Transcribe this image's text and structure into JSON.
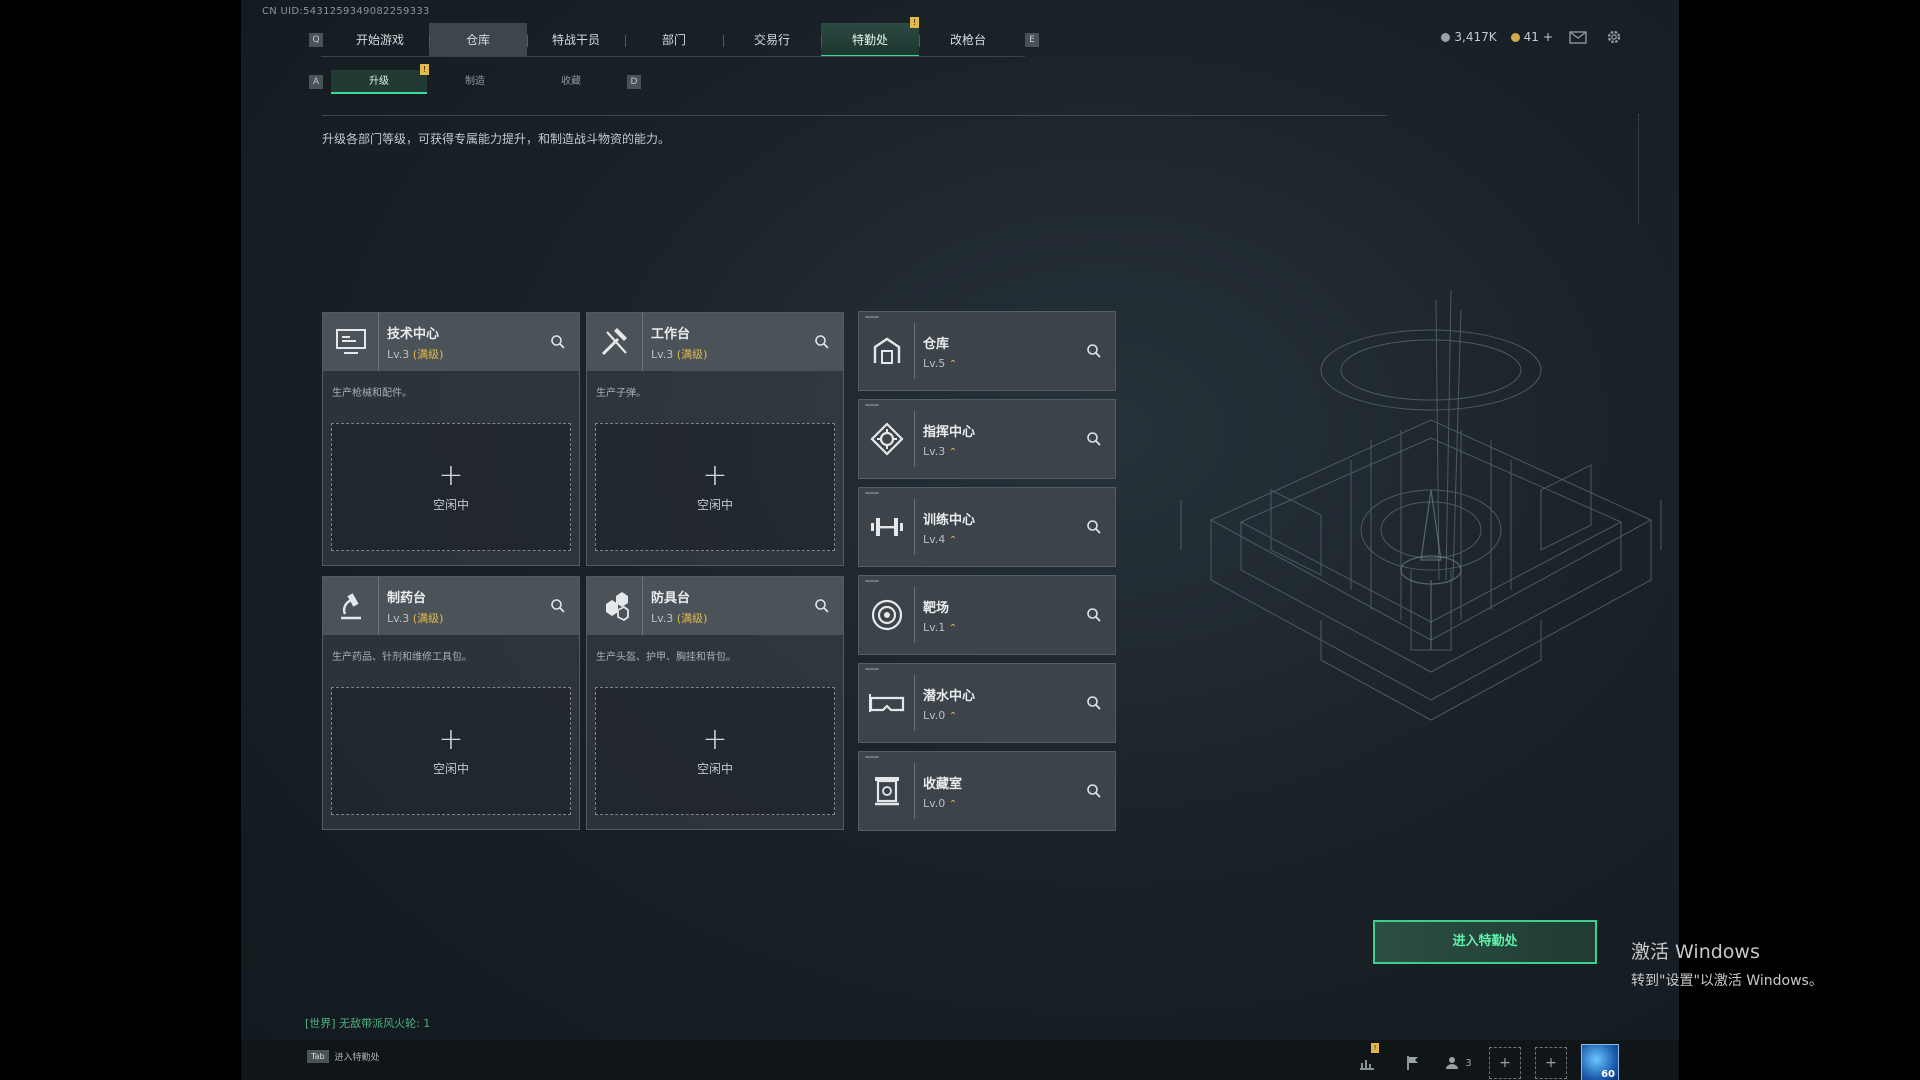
{
  "uid": "CN UID:5431259349082259333",
  "nav": {
    "left_key": "Q",
    "right_key": "E",
    "tabs": [
      "开始游戏",
      "仓库",
      "特战干员",
      "部门",
      "交易行",
      "特勤处",
      "改枪台"
    ],
    "active_tab": "特勤处",
    "alert": "!"
  },
  "resources": {
    "currency": "3,417K",
    "coins": "41",
    "plus": "+"
  },
  "subnav": {
    "left_key": "A",
    "right_key": "D",
    "tabs": [
      "升级",
      "制造",
      "收藏"
    ],
    "active": "升级",
    "alert": "!"
  },
  "description": "升级各部门等级，可获得专属能力提升，和制造战斗物资的能力。",
  "large_cards": [
    {
      "name": "技术中心",
      "level": "Lv.3",
      "max": "(满级)",
      "desc": "生产枪械和配件。",
      "slot": "空闲中",
      "icon": "monitor-icon"
    },
    {
      "name": "工作台",
      "level": "Lv.3",
      "max": "(满级)",
      "desc": "生产子弹。",
      "slot": "空闲中",
      "icon": "hammer-icon"
    },
    {
      "name": "制药台",
      "level": "Lv.3",
      "max": "(满级)",
      "desc": "生产药品、针剂和维修工具包。",
      "slot": "空闲中",
      "icon": "microscope-icon"
    },
    {
      "name": "防具台",
      "level": "Lv.3",
      "max": "(满级)",
      "desc": "生产头盔、护甲、胸挂和背包。",
      "slot": "空闲中",
      "icon": "armor-icon"
    }
  ],
  "small_cards": [
    {
      "name": "仓库",
      "level": "Lv.5",
      "icon": "warehouse-icon"
    },
    {
      "name": "指挥中心",
      "level": "Lv.3",
      "icon": "command-icon"
    },
    {
      "name": "训练中心",
      "level": "Lv.4",
      "icon": "dumbbell-icon"
    },
    {
      "name": "靶场",
      "level": "Lv.1",
      "icon": "target-icon"
    },
    {
      "name": "潜水中心",
      "level": "Lv.0",
      "icon": "goggles-icon"
    },
    {
      "name": "收藏室",
      "level": "Lv.0",
      "icon": "trophy-icon"
    }
  ],
  "enter_button": "进入特勤处",
  "chat_line": "[世界] 无敌带派风火轮: 1",
  "tab_hint": {
    "key": "Tab",
    "label": "进入特勤处"
  },
  "bottom": {
    "friends": "3",
    "avatar_level": "60",
    "alert": "!"
  },
  "activate_windows": {
    "title": "激活 Windows",
    "subtitle": "转到\"设置\"以激活 Windows。"
  },
  "colors": {
    "accent": "#3ed89a",
    "max_level": "#e3b94c",
    "alert": "#e3b94c"
  }
}
